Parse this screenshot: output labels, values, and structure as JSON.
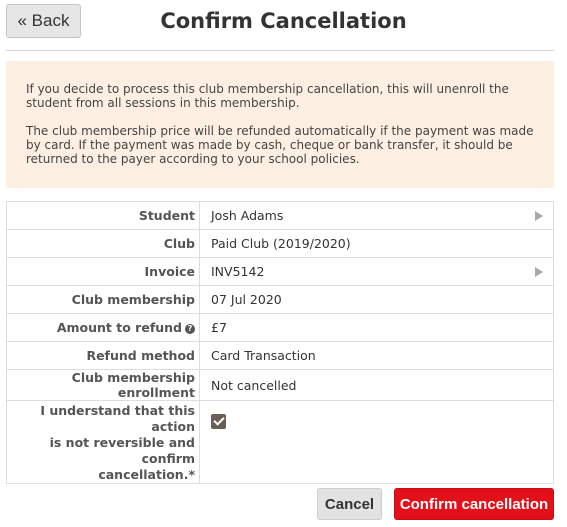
{
  "header": {
    "back_label": "« Back",
    "title": "Confirm Cancellation"
  },
  "notice": {
    "paragraph1": "If you decide to process this club membership cancellation, this will unenroll the student from all sessions in this membership.",
    "paragraph2": "The club membership price will be refunded automatically if the payment was made by card. If the payment was made by cash, cheque or bank transfer, it should be returned to the payer according to your school policies."
  },
  "details": {
    "student": {
      "label": "Student",
      "value": "Josh Adams",
      "icon": "chevron-right-icon"
    },
    "club": {
      "label": "Club",
      "value": "Paid Club (2019/2020)"
    },
    "invoice": {
      "label": "Invoice",
      "value": "INV5142",
      "icon": "chevron-right-icon"
    },
    "membership": {
      "label": "Club membership",
      "value": "07 Jul 2020"
    },
    "refund_amount": {
      "label": "Amount to refund",
      "help": "?",
      "value": "£7"
    },
    "refund_method": {
      "label": "Refund method",
      "value": "Card Transaction"
    },
    "enrollment": {
      "label": "Club membership enrollment",
      "value": "Not cancelled"
    },
    "confirm": {
      "label_line1": "I understand that this action",
      "label_line2": "is not reversible and confirm",
      "label_line3": "cancellation.*",
      "checked": true
    }
  },
  "actions": {
    "cancel_label": "Cancel",
    "confirm_label": "Confirm cancellation"
  },
  "colors": {
    "notice_background": "#fdf0e2",
    "confirm_button": "#e3101a",
    "checkbox": "#6b5e55"
  }
}
